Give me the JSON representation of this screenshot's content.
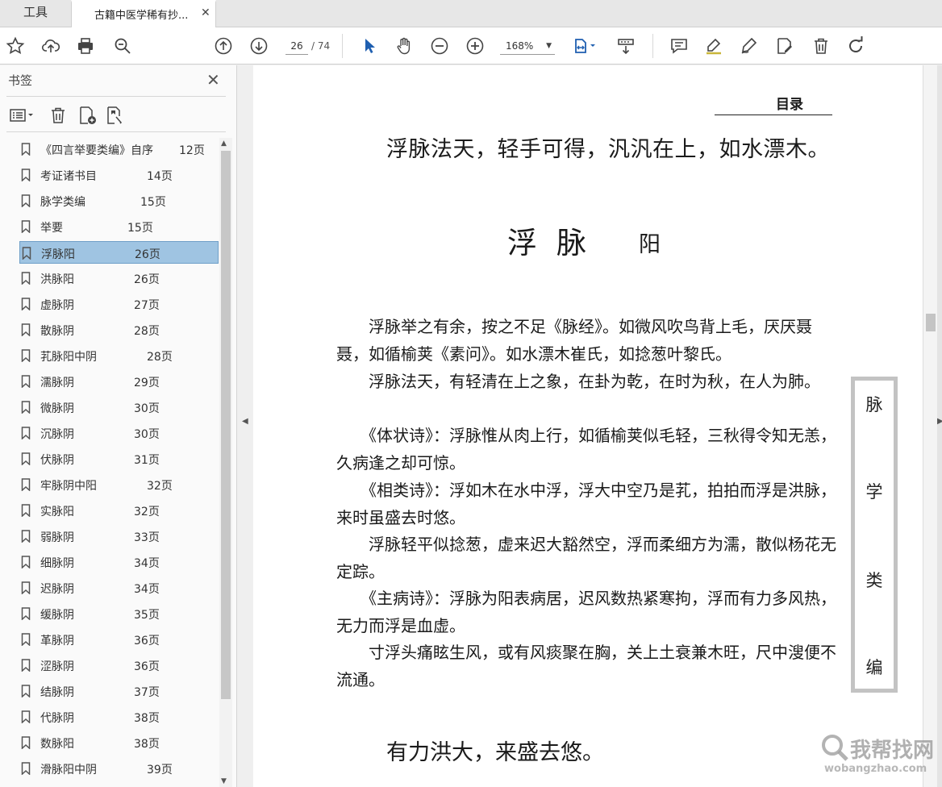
{
  "tabs": {
    "tools_label": "工具",
    "doc_title": "古籍中医学稀有抄...",
    "close_glyph": "✕"
  },
  "toolbar": {
    "current_page": "26",
    "total_pages": "/ 74",
    "zoom": "168%"
  },
  "sidebar": {
    "title": "书签",
    "close_glyph": "✕",
    "bookmarks": [
      {
        "title": "《四言举要类编》自序",
        "page": "12页"
      },
      {
        "title": "考证诸书目",
        "page": "14页"
      },
      {
        "title": "脉学类编",
        "page": "15页"
      },
      {
        "title": "举要",
        "page": "15页"
      },
      {
        "title": "浮脉阳",
        "page": "26页",
        "selected": true
      },
      {
        "title": "洪脉阳",
        "page": "26页"
      },
      {
        "title": "虚脉阴",
        "page": "27页"
      },
      {
        "title": "散脉阴",
        "page": "28页"
      },
      {
        "title": "芤脉阳中阴",
        "page": "28页"
      },
      {
        "title": "濡脉阴",
        "page": "29页"
      },
      {
        "title": "微脉阴",
        "page": "30页"
      },
      {
        "title": "沉脉阴",
        "page": "30页"
      },
      {
        "title": "伏脉阴",
        "page": "31页"
      },
      {
        "title": "牢脉阴中阳",
        "page": "32页"
      },
      {
        "title": "实脉阳",
        "page": "32页"
      },
      {
        "title": "弱脉阴",
        "page": "33页"
      },
      {
        "title": "细脉阴",
        "page": "34页"
      },
      {
        "title": "迟脉阴",
        "page": "34页"
      },
      {
        "title": "缓脉阴",
        "page": "35页"
      },
      {
        "title": "革脉阴",
        "page": "36页"
      },
      {
        "title": "涩脉阴",
        "page": "36页"
      },
      {
        "title": "结脉阴",
        "page": "37页"
      },
      {
        "title": "代脉阴",
        "page": "38页"
      },
      {
        "title": "数脉阳",
        "page": "38页"
      },
      {
        "title": "滑脉阳中阴",
        "page": "39页"
      }
    ]
  },
  "document": {
    "running_head": "目录",
    "verse_top": "浮脉法天，轻手可得，汎汎在上，如水漂木。",
    "heading": "浮脉",
    "heading_small": "阳",
    "paragraphs": [
      "　　浮脉举之有余，按之不足《脉经》。如微风吹鸟背上毛，厌厌聂聂，如循榆荚《素问》。如水漂木崔氏，如捻葱叶黎氏。",
      "　　浮脉法天，有轻清在上之象，在卦为乾，在时为秋，在人为肺。",
      "　　《体状诗》：浮脉惟从肉上行，如循榆荚似毛轻，三秋得令知无恙，久病逢之却可惊。",
      "　　《相类诗》：浮如木在水中浮，浮大中空乃是芤，拍拍而浮是洪脉，来时虽盛去时悠。",
      "　　浮脉轻平似捻葱，虚来迟大豁然空，浮而柔细方为濡，散似杨花无定踪。",
      "　　《主病诗》：浮脉为阳表病居，迟风数热紧寒拘，浮而有力多风热，无力而浮是血虚。",
      "　　寸浮头痛眩生风，或有风痰聚在胸，关上土衰兼木旺，尺中溲便不流通。"
    ],
    "verse_bottom": "有力洪大，来盛去悠。",
    "side_label": [
      "脉",
      "学",
      "类",
      "编"
    ]
  },
  "watermark": {
    "text": "我帮找网",
    "url": "wobangzhao.com"
  },
  "colors": {
    "selected_bookmark": "#9fc4e2",
    "accent_blue": "#1f5fb0"
  }
}
